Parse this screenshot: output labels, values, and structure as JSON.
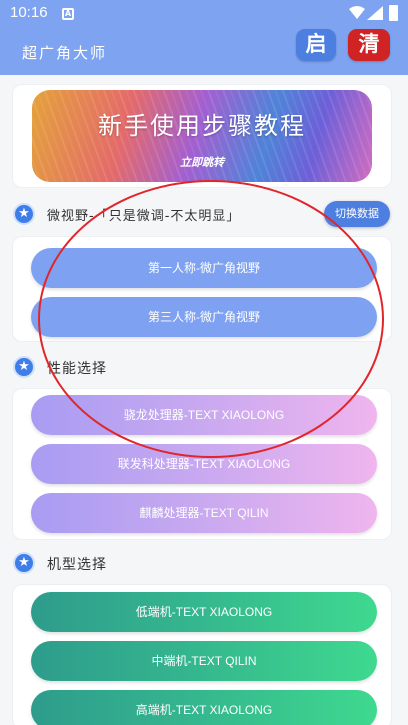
{
  "status_bar": {
    "time": "10:16",
    "notif_icon": "A"
  },
  "header": {
    "title": "超广角大师",
    "start_label": "启",
    "clear_label": "清"
  },
  "banner": {
    "title": "新手使用步骤教程",
    "subtitle": "立即跳转"
  },
  "sections": {
    "view": {
      "label": "微视野-「只是微调-不太明显」",
      "switch_label": "切换数据",
      "options": [
        "第一人称-微广角视野",
        "第三人称-微广角视野"
      ]
    },
    "performance": {
      "label": "性能选择",
      "options": [
        "骁龙处理器-TEXT XIAOLONG",
        "联发科处理器-TEXT XIAOLONG",
        "麒麟处理器-TEXT QILIN"
      ]
    },
    "model": {
      "label": "机型选择",
      "options": [
        "低端机-TEXT XIAOLONG",
        "中端机-TEXT QILIN",
        "高端机-TEXT XIAOLONG"
      ]
    }
  },
  "colors": {
    "header": "#7ea3f0",
    "start_button": "#4d7fe0",
    "clear_button": "#cf2324",
    "annotation": "#e0262a"
  }
}
